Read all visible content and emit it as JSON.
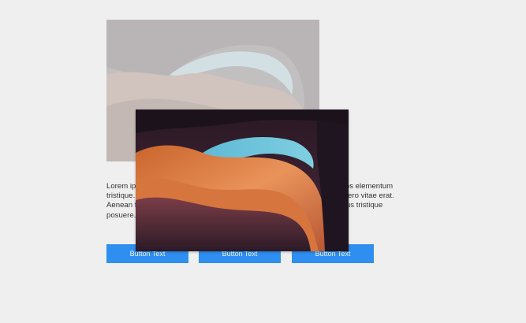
{
  "card": {
    "image_alt": "Antelope canyon sandstone arch",
    "body_text": "Lorem ipsum dolor sit amet, consectetur adipiscing elit. Nulla enim in eros elementum tristique. Duis cursus, mi quis viverra ornare, nulla, ut commodo diam libero vitae erat. Aenean faucibus nibh et justo cursus id imperdiet. Nunc ut sem vitae risus tristique posuere."
  },
  "buttons": {
    "primary_label": "Button Text",
    "secondary_label": "Button Text",
    "tertiary_label": "Button Text"
  },
  "popup": {
    "image_alt": "Antelope canyon sandstone arch"
  },
  "colors": {
    "background": "#efefef",
    "button": "#2f8ff0",
    "sky": "#6cc3dc",
    "rock_light": "#e58a4a",
    "rock_dark": "#3a1f2e"
  }
}
